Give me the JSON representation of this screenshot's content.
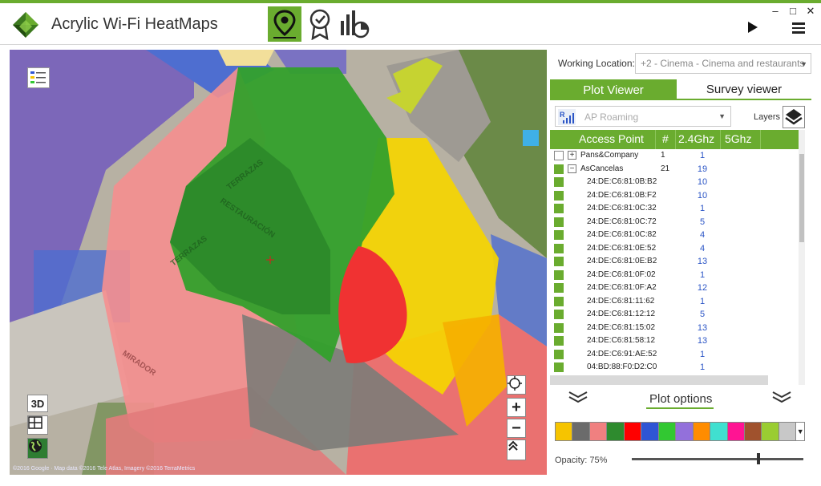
{
  "app": {
    "title": "Acrylic Wi-Fi HeatMaps"
  },
  "window_controls": {
    "minimize": "–",
    "maximize": "□",
    "close": "✕"
  },
  "toolbar": {
    "icons": [
      "map-pin-icon",
      "certificate-icon",
      "reports-chart-icon"
    ],
    "colors": {
      "accent": "#6aac2f"
    }
  },
  "map": {
    "copyright": "©2016 Google · Map data ©2016 Tele Atlas, Imagery ©2016 TerraMetrics",
    "zoom_in": "+",
    "zoom_out": "−",
    "mode_3d": "3D",
    "street_labels": [
      "TERRAZAS",
      "RESTAURACIÓN",
      "TERRAZAS",
      "MIRADOR"
    ]
  },
  "working_location": {
    "label": "Working Location:",
    "value": "+2 - Cinema - Cinema and restaurants"
  },
  "tabs": [
    {
      "label": "Plot Viewer",
      "active": true
    },
    {
      "label": "Survey viewer",
      "active": false
    }
  ],
  "ap_roaming": {
    "value": "AP Roaming"
  },
  "layers": {
    "label": "Layers"
  },
  "grid": {
    "headers": [
      "Access Point",
      "#",
      "2.4Ghz",
      "5Ghz"
    ],
    "rows": [
      {
        "name": "Pans&Company",
        "count": "1",
        "g24": "1",
        "level": 0,
        "expander": "+",
        "checked": false
      },
      {
        "name": "AsCancelas",
        "count": "21",
        "g24": "19",
        "level": 0,
        "expander": "−",
        "checked": true
      },
      {
        "name": "24:DE:C6:81:0B:B2",
        "count": "",
        "g24": "10",
        "level": 1,
        "checked": true
      },
      {
        "name": "24:DE:C6:81:0B:F2",
        "count": "",
        "g24": "10",
        "level": 1,
        "checked": true
      },
      {
        "name": "24:DE:C6:81:0C:32",
        "count": "",
        "g24": "1",
        "level": 1,
        "checked": true
      },
      {
        "name": "24:DE:C6:81:0C:72",
        "count": "",
        "g24": "5",
        "level": 1,
        "checked": true
      },
      {
        "name": "24:DE:C6:81:0C:82",
        "count": "",
        "g24": "4",
        "level": 1,
        "checked": true
      },
      {
        "name": "24:DE:C6:81:0E:52",
        "count": "",
        "g24": "4",
        "level": 1,
        "checked": true
      },
      {
        "name": "24:DE:C6:81:0E:B2",
        "count": "",
        "g24": "13",
        "level": 1,
        "checked": true
      },
      {
        "name": "24:DE:C6:81:0F:02",
        "count": "",
        "g24": "1",
        "level": 1,
        "checked": true
      },
      {
        "name": "24:DE:C6:81:0F:A2",
        "count": "",
        "g24": "12",
        "level": 1,
        "checked": true
      },
      {
        "name": "24:DE:C6:81:11:62",
        "count": "",
        "g24": "1",
        "level": 1,
        "checked": true
      },
      {
        "name": "24:DE:C6:81:12:12",
        "count": "",
        "g24": "5",
        "level": 1,
        "checked": true
      },
      {
        "name": "24:DE:C6:81:15:02",
        "count": "",
        "g24": "13",
        "level": 1,
        "checked": true
      },
      {
        "name": "24:DE:C6:81:58:12",
        "count": "",
        "g24": "13",
        "level": 1,
        "checked": true
      },
      {
        "name": "24:DE:C6:91:AE:52",
        "count": "",
        "g24": "1",
        "level": 1,
        "checked": true
      },
      {
        "name": "04:BD:88:F0:D2:C0",
        "count": "",
        "g24": "1",
        "level": 1,
        "checked": true
      }
    ]
  },
  "plot_options": {
    "label": "Plot options",
    "palette": [
      "#f6c400",
      "#6b6b6b",
      "#f08080",
      "#2e8b2e",
      "#ff0000",
      "#2f55d4",
      "#32c832",
      "#9370db",
      "#ff8c00",
      "#40e0d0",
      "#ff1493",
      "#a0522d",
      "#9acd32",
      "#c8c8c8"
    ],
    "opacity_label": "Opacity: 75%",
    "opacity_value": 0.75
  }
}
